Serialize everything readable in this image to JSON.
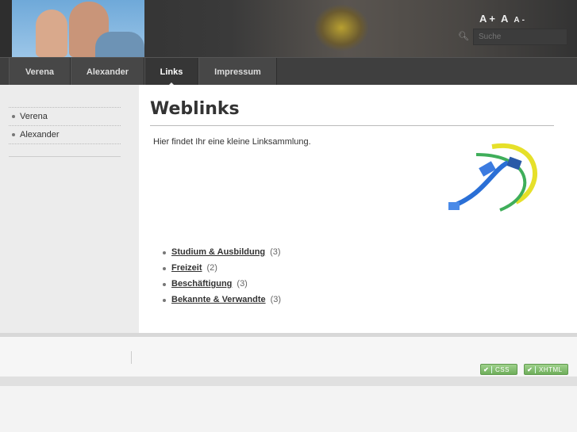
{
  "header": {
    "font_size_controls": [
      "A+",
      "A",
      "A-"
    ],
    "search_placeholder": "Suche"
  },
  "nav": {
    "tabs": [
      {
        "label": "Verena"
      },
      {
        "label": "Alexander"
      },
      {
        "label": "Links",
        "active": true
      },
      {
        "label": "Impressum"
      }
    ]
  },
  "sidebar": {
    "items": [
      "Verena",
      "Alexander"
    ]
  },
  "main": {
    "title": "Weblinks",
    "intro": "Hier findet Ihr eine kleine Linksammlung.",
    "links": [
      {
        "label": "Studium & Ausbildung",
        "count": "(3)"
      },
      {
        "label": "Freizeit",
        "count": "(2)"
      },
      {
        "label": "Beschäftigung",
        "count": "(3)"
      },
      {
        "label": "Bekannte & Verwandte",
        "count": "(3)"
      }
    ]
  },
  "footer": {
    "badges": [
      "CSS",
      "XHTML"
    ],
    "badge_check": "✔",
    "badge_color": "#7dbb68"
  }
}
